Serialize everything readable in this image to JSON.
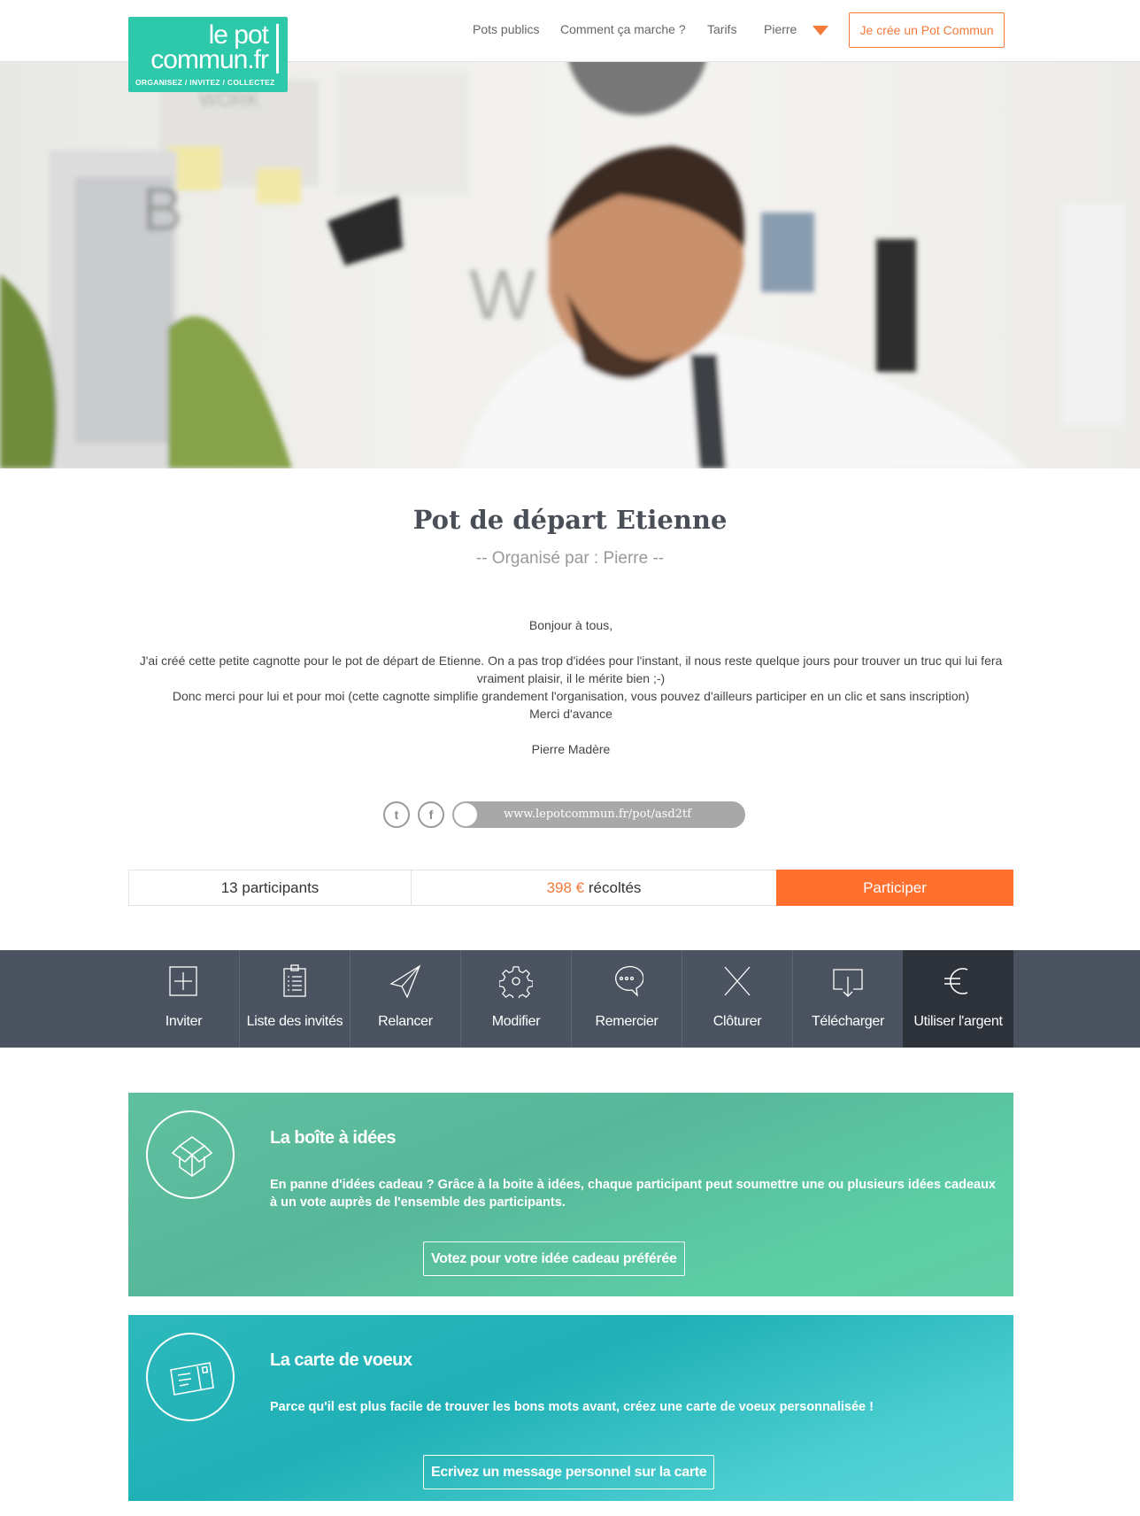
{
  "header": {
    "logo": {
      "line1": "le pot",
      "line2": "commun.fr",
      "tagline": "ORGANISEZ / INVITEZ / COLLECTEZ",
      "color": "#2ec8ab"
    },
    "nav": [
      "Pots publics",
      "Comment ça marche ?",
      "Tarifs"
    ],
    "user": "Pierre",
    "create_button": "Je crée un Pot Commun"
  },
  "pot": {
    "title": "Pot de départ Etienne",
    "subtitle": "-- Organisé par : Pierre --",
    "message": [
      "Bonjour à tous,",
      "",
      "J'ai créé cette petite cagnotte pour le pot de départ de Etienne. On a pas trop d'idées pour l'instant, il nous reste quelque jours pour trouver un truc qui lui fera vraiment plaisir, il le mérite bien ;-)",
      "Donc merci pour lui et pour moi (cette cagnotte simplifie grandement l'organisation, vous pouvez d'ailleurs participer en un clic et sans inscription)",
      "Merci d'avance",
      "",
      "Pierre Madère"
    ],
    "share": {
      "twitter_icon": "twitter-icon",
      "facebook_icon": "facebook-icon",
      "url": "www.lepotcommun.fr/pot/asd2tf"
    }
  },
  "stats": {
    "participants_count": "13",
    "participants_label": "participants",
    "amount": "398 €",
    "amount_label": "récoltés",
    "participate_button": "Participer",
    "accent": "#ff6f2e"
  },
  "actions": [
    {
      "label": "Inviter",
      "icon": "plus-square-icon"
    },
    {
      "label": "Liste des invités",
      "icon": "clipboard-list-icon"
    },
    {
      "label": "Relancer",
      "icon": "paper-plane-icon"
    },
    {
      "label": "Modifier",
      "icon": "gear-icon"
    },
    {
      "label": "Remercier",
      "icon": "speech-bubble-icon"
    },
    {
      "label": "Clôturer",
      "icon": "close-icon"
    },
    {
      "label": "Télécharger",
      "icon": "download-icon"
    },
    {
      "label": "Utiliser l'argent",
      "icon": "euro-icon"
    }
  ],
  "features": [
    {
      "title": "La boîte à idées",
      "text": "En panne d'idées cadeau ? Grâce à la boite à idées, chaque participant peut soumettre une ou plusieurs idées cadeaux à un vote auprès de l'ensemble des participants.",
      "button": "Votez pour votre idée cadeau préférée",
      "icon": "box-icon"
    },
    {
      "title": "La carte de voeux",
      "text": "Parce qu'il est plus facile de trouver les bons mots avant, créez une carte de voeux personnalisée !",
      "button": "Ecrivez un message personnel sur la carte",
      "icon": "postcard-icon"
    }
  ]
}
